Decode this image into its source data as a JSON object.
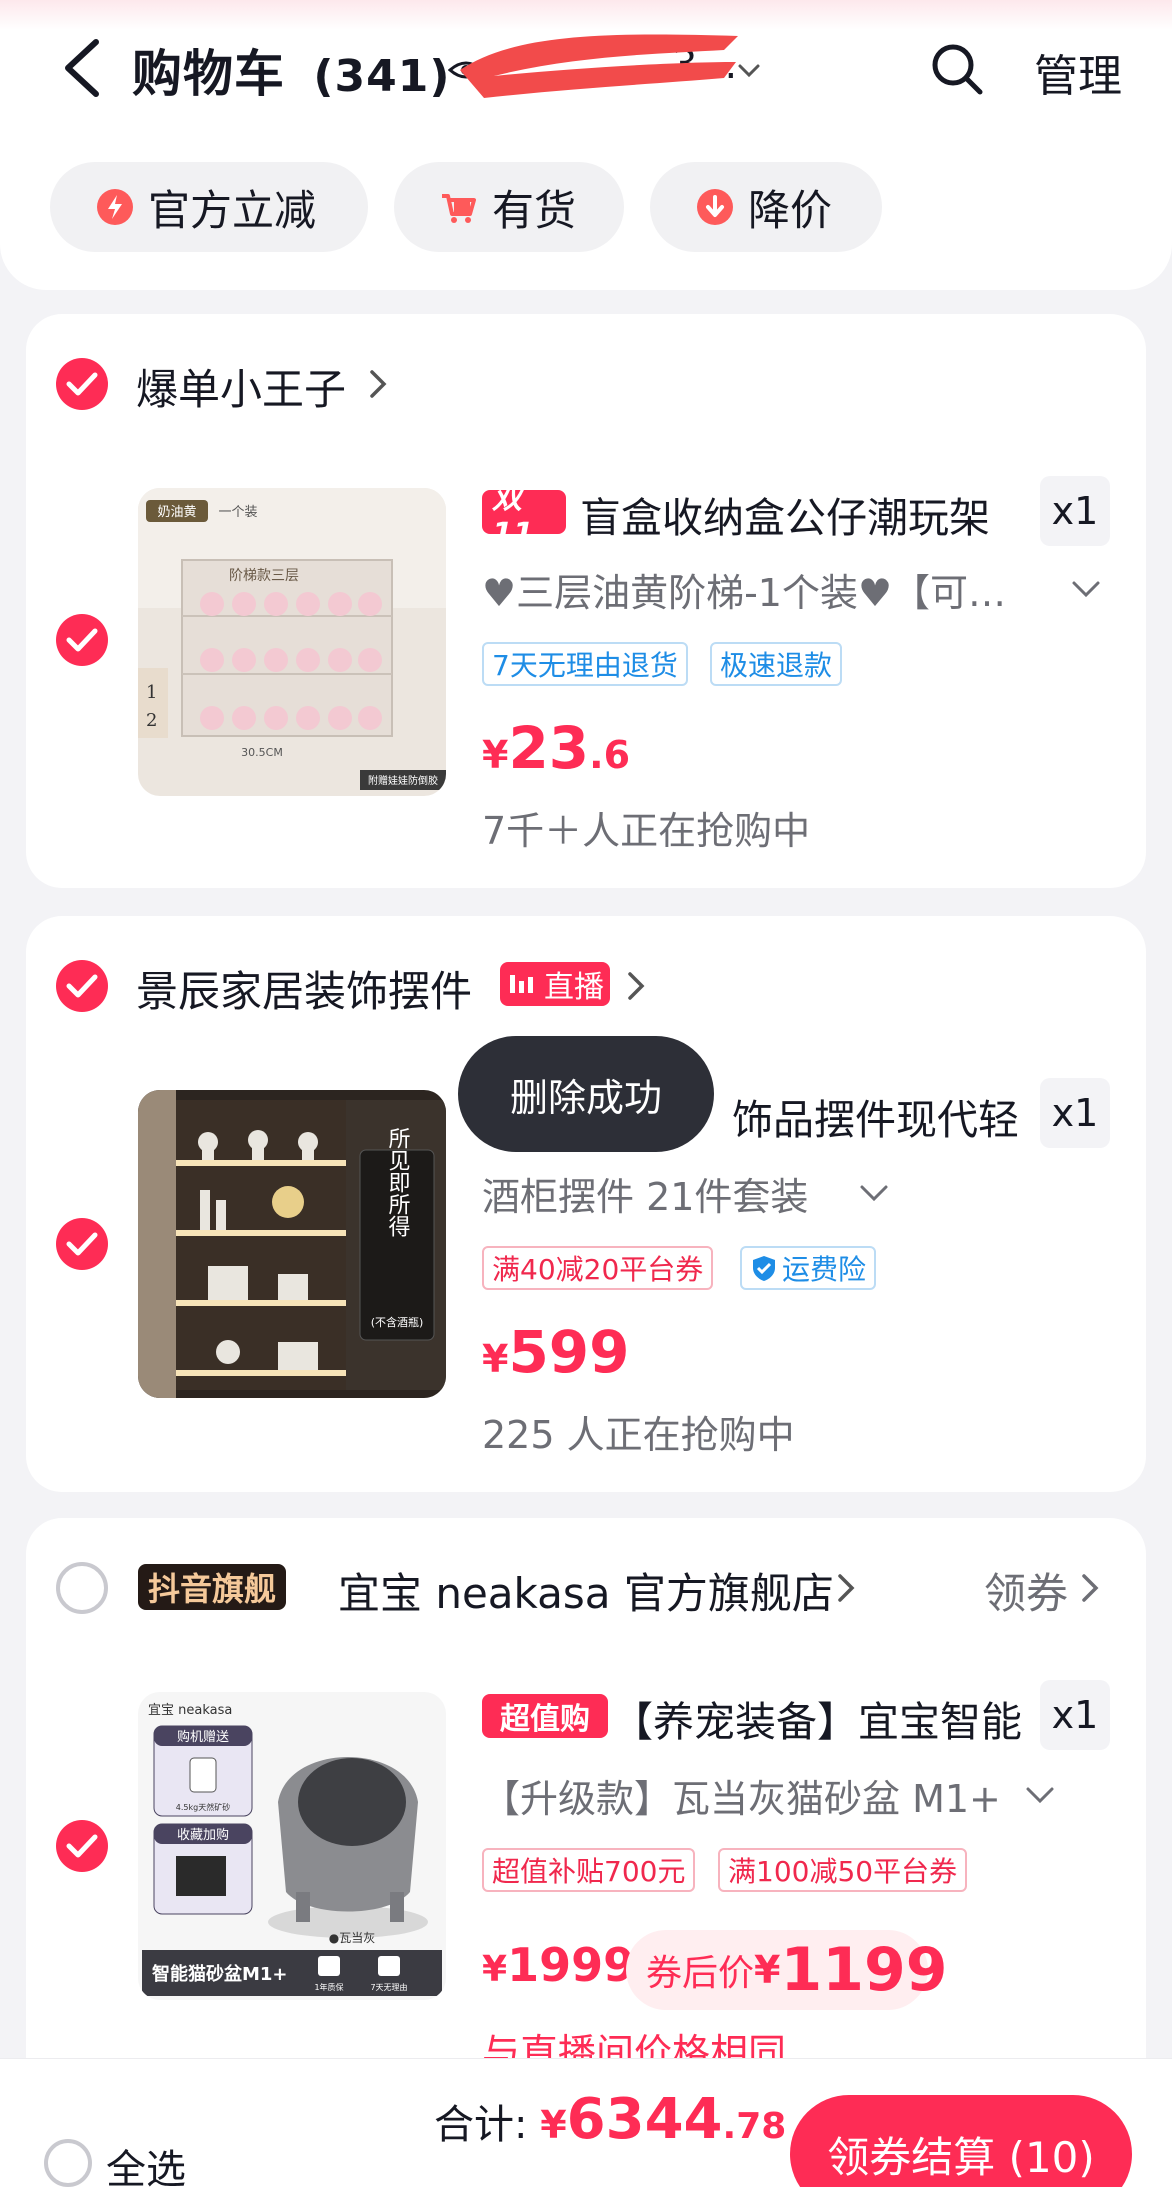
{
  "header": {
    "title": "购物车",
    "count": "(341)",
    "account_visible": "3…",
    "manage_label": "管理"
  },
  "filters": [
    {
      "label": "官方立减"
    },
    {
      "label": "有货"
    },
    {
      "label": "降价"
    }
  ],
  "shops": [
    {
      "name": "爆单小王子",
      "checked": true,
      "item": {
        "checked": true,
        "badge": "双11",
        "title": "盲盒收纳盒公仔潮玩架",
        "qty": "x1",
        "spec": "♥三层油黄阶梯-1个装♥【可…",
        "tags": [
          "7天无理由退货",
          "极速退款"
        ],
        "price_symbol": "¥",
        "price_int": "23",
        "price_dec": ".6",
        "sub": "7千＋人正在抢购中",
        "thumb_text": [
          "奶油黄",
          "一个装",
          "阶梯款三层",
          "30.5CM",
          "附赠娃娃防倒胶",
          "1",
          "2"
        ]
      }
    },
    {
      "name": "景辰家居装饰摆件",
      "live_label": "直播",
      "checked": true,
      "item": {
        "checked": true,
        "title": "饰品摆件现代轻",
        "qty": "x1",
        "spec": "酒柜摆件 21件套装",
        "tags": [
          "满40减20平台券",
          "运费险"
        ],
        "price_symbol": "¥",
        "price_int": "599",
        "sub": "225 人正在抢购中",
        "thumb_text": [
          "所见即所得",
          "(不含酒瓶)"
        ]
      }
    },
    {
      "badge": "抖音旗舰",
      "name": "宜宝 neakasa 官方旗舰店",
      "coupon_label": "领券",
      "checked": false,
      "item": {
        "checked": true,
        "badge": "超值购",
        "title": "【养宠装备】宜宝智能",
        "qty": "x1",
        "spec": "【升级款】瓦当灰猫砂盆 M1+",
        "tags": [
          "超值补贴700元",
          "满100减50平台券"
        ],
        "price_symbol": "¥",
        "price_orig": "1999",
        "coupon_prefix": "券后价",
        "coupon_price": "1199",
        "sub": "与直播间价格相同",
        "thumb_text": [
          "宜宝 neakasa",
          "购机赠送",
          "4.5kg天然矿砂",
          "收藏加购",
          "智能猫砂盆M1+",
          "●瓦当灰",
          "1年质保",
          "7天无理由"
        ]
      }
    }
  ],
  "toast": "删除成功",
  "footer": {
    "select_all": "全选",
    "total_label": "合计:",
    "total_symbol": "¥",
    "total_int": "6344",
    "total_dec": ".78",
    "checkout": "领券结算 (10)"
  },
  "colors": {
    "accent": "#fe2c55",
    "blue_tag": "#1e8de6",
    "bg": "#f3f3f6"
  }
}
